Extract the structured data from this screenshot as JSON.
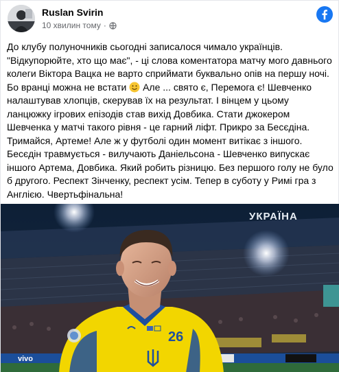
{
  "post": {
    "author": "Ruslan Svirin",
    "timestamp": "10 хвилин тому",
    "body_parts": [
      "До клубу полуночників сьогодні записалося чимало українців. \"Відкупорюйте, хто що має\", - ці слова коментатора матчу мого давнього колеги Віктора Вацка не варто сприймати буквально опів на першу ночі. Бо вранці можна не встати ",
      " Але ... свято є, Перемога є! Шевченко налаштував хлопців, скерував їх на результат. І вінцем у цьому ланцюжку ігрових епізодів став вихід Довбика. Стати джокером Шевченка у матчі такого рівня - це гарний ліфт. Прикро за Бесєдіна. Тримайся, Артеме! Але ж у футболі один момент витікає з іншого. Бесєдін травмується - вилучають Даніельсона - Шевченко випускає іншого Артема, Довбика. Який робить різницю. Без першого голу не було б другого. Респект Зінченку, респект усім. Тепер в суботу у Римі гра з Англією. Чвертьфінальна!"
    ],
    "photo": {
      "channel_logo": "УКРАЇНА",
      "jersey_number": "26",
      "sponsor_text": "vivo"
    }
  },
  "colors": {
    "facebook_blue": "#1877f2",
    "jersey_yellow": "#f2d600",
    "jersey_blue": "#1d4f9e",
    "meta_gray": "#65676b"
  },
  "icons": [
    "facebook-icon",
    "globe-icon",
    "smile-emoji"
  ]
}
